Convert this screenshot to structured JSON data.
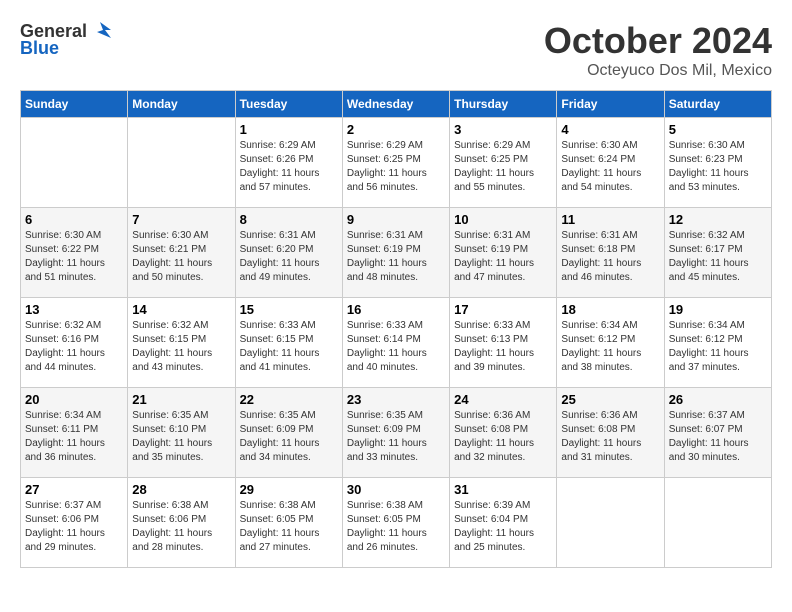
{
  "header": {
    "logo": {
      "general": "General",
      "blue": "Blue"
    },
    "month": "October 2024",
    "location": "Octeyuco Dos Mil, Mexico"
  },
  "weekdays": [
    "Sunday",
    "Monday",
    "Tuesday",
    "Wednesday",
    "Thursday",
    "Friday",
    "Saturday"
  ],
  "weeks": [
    [
      {
        "day": "",
        "info": ""
      },
      {
        "day": "",
        "info": ""
      },
      {
        "day": "1",
        "sunrise": "Sunrise: 6:29 AM",
        "sunset": "Sunset: 6:26 PM",
        "daylight": "Daylight: 11 hours and 57 minutes."
      },
      {
        "day": "2",
        "sunrise": "Sunrise: 6:29 AM",
        "sunset": "Sunset: 6:25 PM",
        "daylight": "Daylight: 11 hours and 56 minutes."
      },
      {
        "day": "3",
        "sunrise": "Sunrise: 6:29 AM",
        "sunset": "Sunset: 6:25 PM",
        "daylight": "Daylight: 11 hours and 55 minutes."
      },
      {
        "day": "4",
        "sunrise": "Sunrise: 6:30 AM",
        "sunset": "Sunset: 6:24 PM",
        "daylight": "Daylight: 11 hours and 54 minutes."
      },
      {
        "day": "5",
        "sunrise": "Sunrise: 6:30 AM",
        "sunset": "Sunset: 6:23 PM",
        "daylight": "Daylight: 11 hours and 53 minutes."
      }
    ],
    [
      {
        "day": "6",
        "sunrise": "Sunrise: 6:30 AM",
        "sunset": "Sunset: 6:22 PM",
        "daylight": "Daylight: 11 hours and 51 minutes."
      },
      {
        "day": "7",
        "sunrise": "Sunrise: 6:30 AM",
        "sunset": "Sunset: 6:21 PM",
        "daylight": "Daylight: 11 hours and 50 minutes."
      },
      {
        "day": "8",
        "sunrise": "Sunrise: 6:31 AM",
        "sunset": "Sunset: 6:20 PM",
        "daylight": "Daylight: 11 hours and 49 minutes."
      },
      {
        "day": "9",
        "sunrise": "Sunrise: 6:31 AM",
        "sunset": "Sunset: 6:19 PM",
        "daylight": "Daylight: 11 hours and 48 minutes."
      },
      {
        "day": "10",
        "sunrise": "Sunrise: 6:31 AM",
        "sunset": "Sunset: 6:19 PM",
        "daylight": "Daylight: 11 hours and 47 minutes."
      },
      {
        "day": "11",
        "sunrise": "Sunrise: 6:31 AM",
        "sunset": "Sunset: 6:18 PM",
        "daylight": "Daylight: 11 hours and 46 minutes."
      },
      {
        "day": "12",
        "sunrise": "Sunrise: 6:32 AM",
        "sunset": "Sunset: 6:17 PM",
        "daylight": "Daylight: 11 hours and 45 minutes."
      }
    ],
    [
      {
        "day": "13",
        "sunrise": "Sunrise: 6:32 AM",
        "sunset": "Sunset: 6:16 PM",
        "daylight": "Daylight: 11 hours and 44 minutes."
      },
      {
        "day": "14",
        "sunrise": "Sunrise: 6:32 AM",
        "sunset": "Sunset: 6:15 PM",
        "daylight": "Daylight: 11 hours and 43 minutes."
      },
      {
        "day": "15",
        "sunrise": "Sunrise: 6:33 AM",
        "sunset": "Sunset: 6:15 PM",
        "daylight": "Daylight: 11 hours and 41 minutes."
      },
      {
        "day": "16",
        "sunrise": "Sunrise: 6:33 AM",
        "sunset": "Sunset: 6:14 PM",
        "daylight": "Daylight: 11 hours and 40 minutes."
      },
      {
        "day": "17",
        "sunrise": "Sunrise: 6:33 AM",
        "sunset": "Sunset: 6:13 PM",
        "daylight": "Daylight: 11 hours and 39 minutes."
      },
      {
        "day": "18",
        "sunrise": "Sunrise: 6:34 AM",
        "sunset": "Sunset: 6:12 PM",
        "daylight": "Daylight: 11 hours and 38 minutes."
      },
      {
        "day": "19",
        "sunrise": "Sunrise: 6:34 AM",
        "sunset": "Sunset: 6:12 PM",
        "daylight": "Daylight: 11 hours and 37 minutes."
      }
    ],
    [
      {
        "day": "20",
        "sunrise": "Sunrise: 6:34 AM",
        "sunset": "Sunset: 6:11 PM",
        "daylight": "Daylight: 11 hours and 36 minutes."
      },
      {
        "day": "21",
        "sunrise": "Sunrise: 6:35 AM",
        "sunset": "Sunset: 6:10 PM",
        "daylight": "Daylight: 11 hours and 35 minutes."
      },
      {
        "day": "22",
        "sunrise": "Sunrise: 6:35 AM",
        "sunset": "Sunset: 6:09 PM",
        "daylight": "Daylight: 11 hours and 34 minutes."
      },
      {
        "day": "23",
        "sunrise": "Sunrise: 6:35 AM",
        "sunset": "Sunset: 6:09 PM",
        "daylight": "Daylight: 11 hours and 33 minutes."
      },
      {
        "day": "24",
        "sunrise": "Sunrise: 6:36 AM",
        "sunset": "Sunset: 6:08 PM",
        "daylight": "Daylight: 11 hours and 32 minutes."
      },
      {
        "day": "25",
        "sunrise": "Sunrise: 6:36 AM",
        "sunset": "Sunset: 6:08 PM",
        "daylight": "Daylight: 11 hours and 31 minutes."
      },
      {
        "day": "26",
        "sunrise": "Sunrise: 6:37 AM",
        "sunset": "Sunset: 6:07 PM",
        "daylight": "Daylight: 11 hours and 30 minutes."
      }
    ],
    [
      {
        "day": "27",
        "sunrise": "Sunrise: 6:37 AM",
        "sunset": "Sunset: 6:06 PM",
        "daylight": "Daylight: 11 hours and 29 minutes."
      },
      {
        "day": "28",
        "sunrise": "Sunrise: 6:38 AM",
        "sunset": "Sunset: 6:06 PM",
        "daylight": "Daylight: 11 hours and 28 minutes."
      },
      {
        "day": "29",
        "sunrise": "Sunrise: 6:38 AM",
        "sunset": "Sunset: 6:05 PM",
        "daylight": "Daylight: 11 hours and 27 minutes."
      },
      {
        "day": "30",
        "sunrise": "Sunrise: 6:38 AM",
        "sunset": "Sunset: 6:05 PM",
        "daylight": "Daylight: 11 hours and 26 minutes."
      },
      {
        "day": "31",
        "sunrise": "Sunrise: 6:39 AM",
        "sunset": "Sunset: 6:04 PM",
        "daylight": "Daylight: 11 hours and 25 minutes."
      },
      {
        "day": "",
        "info": ""
      },
      {
        "day": "",
        "info": ""
      }
    ]
  ]
}
